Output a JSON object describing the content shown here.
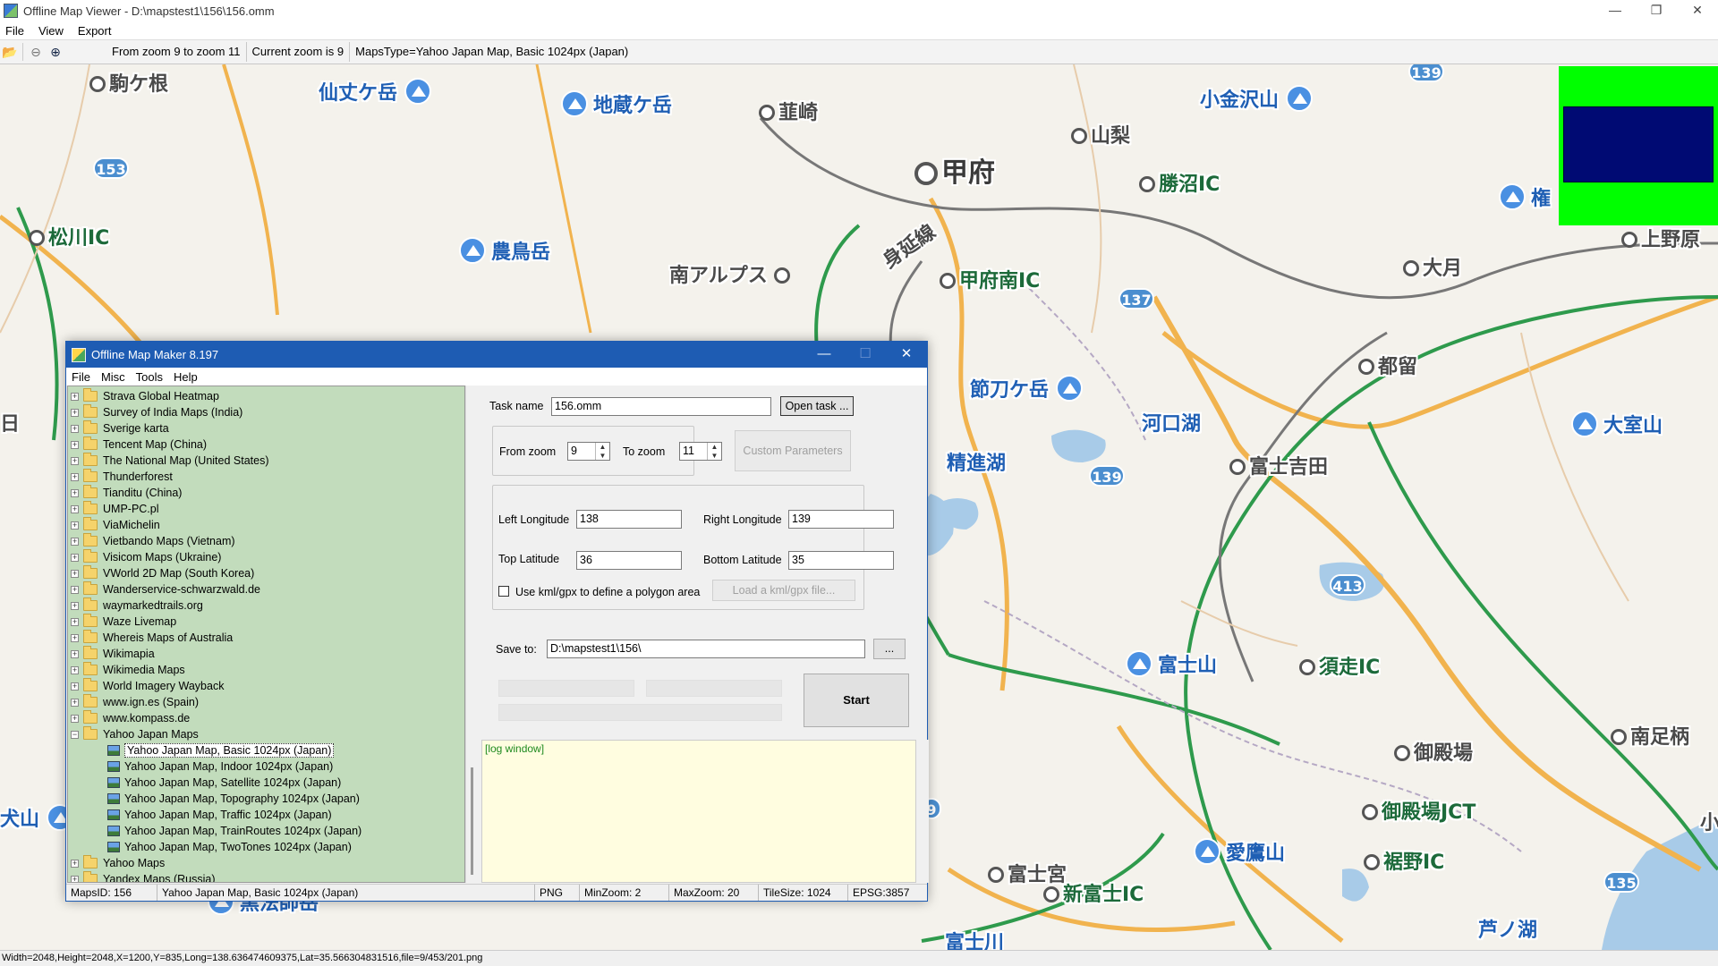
{
  "window": {
    "title": "Offline Map Viewer - D:\\mapstest1\\156\\156.omm",
    "menu": [
      "File",
      "View",
      "Export"
    ],
    "controls": {
      "minimize": "—",
      "maximize": "❐",
      "close": "✕"
    }
  },
  "toolbar": {
    "zoom_range": "From zoom 9 to zoom 11",
    "current_zoom": "Current zoom is 9",
    "maps_type": "MapsType=Yahoo Japan Map, Basic 1024px (Japan)"
  },
  "map": {
    "labels": {
      "komagane": "駒ケ根",
      "senjogatake": "仙丈ケ岳",
      "jizogatake": "地蔵ケ岳",
      "nirasaki": "韮崎",
      "kokinzawa": "小金沢山",
      "yamanashi": "山梨",
      "kofu": "甲府",
      "katsunuma": "勝沼IC",
      "minobu": "身延線",
      "matsukawa": "松川IC",
      "notori": "農鳥岳",
      "minamialps": "南アルプス",
      "kofuminami": "甲府南IC",
      "uenohara": "上野原",
      "otsuki": "大月",
      "gon": "権",
      "tsuru": "都留",
      "kenashi": "節刀ケ岳",
      "kawaguchiko": "河口湖",
      "omuro": "大室山",
      "shojiko": "精進湖",
      "fujiyoshida": "富士吉田",
      "fujisan": "富士山",
      "subashiri": "須走IC",
      "minamiashigara": "南足柄",
      "gotemba": "御殿場",
      "gotembajct": "御殿場JCT",
      "inu": "犬山",
      "aitaka": "愛鷹山",
      "fujinomiya": "富士宮",
      "susono": "裾野IC",
      "kurohoshi": "黒法師岳",
      "shinfuji": "新富士IC",
      "fujikawa": "富士川",
      "ashinoko": "芦ノ湖",
      "ko": "小",
      "hi": "日"
    },
    "shields": [
      "139",
      "153",
      "137",
      "139",
      "413",
      "9",
      "135"
    ]
  },
  "statusbar": "Width=2048,Height=2048,X=1200,Y=835,Long=138.636474609375,Lat=35.566304831516,file=9/453/201.png",
  "dialog": {
    "title": "Offline Map Maker 8.197",
    "menu": [
      "File",
      "Misc",
      "Tools",
      "Help"
    ],
    "tree": [
      {
        "label": "Strava Global Heatmap",
        "type": "folder"
      },
      {
        "label": "Survey of India Maps (India)",
        "type": "folder"
      },
      {
        "label": "Sverige karta",
        "type": "folder"
      },
      {
        "label": "Tencent Map (China)",
        "type": "folder"
      },
      {
        "label": "The National Map (United States)",
        "type": "folder"
      },
      {
        "label": "Thunderforest",
        "type": "folder"
      },
      {
        "label": "Tianditu (China)",
        "type": "folder"
      },
      {
        "label": "UMP-PC.pl",
        "type": "folder"
      },
      {
        "label": "ViaMichelin",
        "type": "folder"
      },
      {
        "label": "Vietbando Maps (Vietnam)",
        "type": "folder"
      },
      {
        "label": "Visicom Maps (Ukraine)",
        "type": "folder"
      },
      {
        "label": "VWorld 2D Map (South Korea)",
        "type": "folder"
      },
      {
        "label": "Wanderservice-schwarzwald.de",
        "type": "folder"
      },
      {
        "label": "waymarkedtrails.org",
        "type": "folder"
      },
      {
        "label": "Waze Livemap",
        "type": "folder"
      },
      {
        "label": "Whereis Maps of Australia",
        "type": "folder"
      },
      {
        "label": "Wikimapia",
        "type": "folder"
      },
      {
        "label": "Wikimedia Maps",
        "type": "folder"
      },
      {
        "label": "World Imagery Wayback",
        "type": "folder"
      },
      {
        "label": "www.ign.es (Spain)",
        "type": "folder"
      },
      {
        "label": "www.kompass.de",
        "type": "folder"
      },
      {
        "label": "Yahoo Japan Maps",
        "type": "folder-open"
      },
      {
        "label": "Yahoo Japan Map, Basic 1024px (Japan)",
        "type": "map",
        "selected": true
      },
      {
        "label": "Yahoo Japan Map, Indoor 1024px (Japan)",
        "type": "map"
      },
      {
        "label": "Yahoo Japan Map, Satellite 1024px (Japan)",
        "type": "map"
      },
      {
        "label": "Yahoo Japan Map, Topography 1024px (Japan)",
        "type": "map"
      },
      {
        "label": "Yahoo Japan Map, Traffic 1024px (Japan)",
        "type": "map"
      },
      {
        "label": "Yahoo Japan Map, TrainRoutes 1024px (Japan)",
        "type": "map"
      },
      {
        "label": "Yahoo Japan Map, TwoTones 1024px (Japan)",
        "type": "map"
      },
      {
        "label": "Yahoo Maps",
        "type": "folder"
      },
      {
        "label": "Yandex Maps (Russia)",
        "type": "folder"
      }
    ],
    "form": {
      "task_name_label": "Task name",
      "task_name": "156.omm",
      "open_task": "Open task ...",
      "from_zoom_label": "From zoom",
      "from_zoom": "9",
      "to_zoom_label": "To zoom",
      "to_zoom": "11",
      "custom_params": "Custom Parameters",
      "left_lon_label": "Left Longitude",
      "left_lon": "138",
      "right_lon_label": "Right Longitude",
      "right_lon": "139",
      "top_lat_label": "Top Latitude",
      "top_lat": "36",
      "bottom_lat_label": "Bottom Latitude",
      "bottom_lat": "35",
      "kml_label": "Use kml/gpx to define a polygon area",
      "load_kml": "Load a kml/gpx file...",
      "save_to_label": "Save to:",
      "save_to": "D:\\mapstest1\\156\\",
      "browse": "...",
      "start": "Start",
      "log": "[log window]"
    },
    "status": {
      "maps_id": "MapsID: 156",
      "maps_name": "Yahoo Japan Map, Basic 1024px (Japan)",
      "format": "PNG",
      "min_zoom": "MinZoom: 2",
      "max_zoom": "MaxZoom: 20",
      "tile_size": "TileSize: 1024",
      "epsg": "EPSG:3857"
    }
  }
}
